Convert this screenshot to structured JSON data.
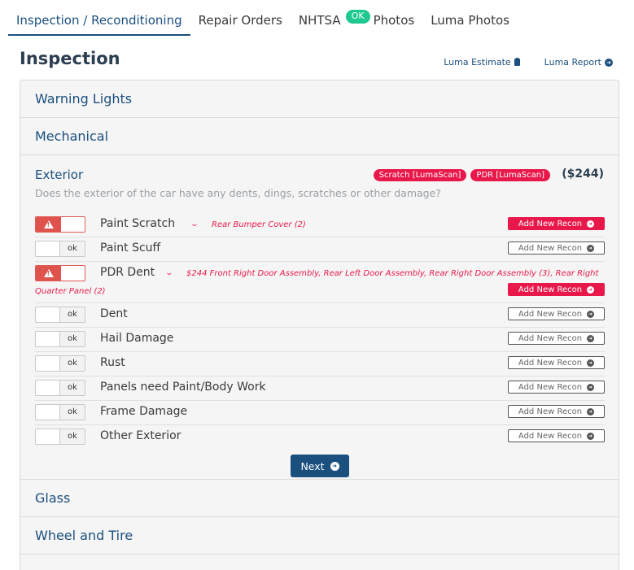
{
  "tabs": [
    {
      "label": "Inspection / Reconditioning"
    },
    {
      "label": "Repair Orders"
    },
    {
      "label": "NHTSA",
      "badge": "OK"
    },
    {
      "label": "Photos"
    },
    {
      "label": "Luma Photos"
    }
  ],
  "page": {
    "title": "Inspection",
    "luma_estimate": "Luma Estimate",
    "luma_report": "Luma Report"
  },
  "sections": {
    "warning_lights": "Warning Lights",
    "mechanical": "Mechanical",
    "glass": "Glass",
    "wheel_tire": "Wheel and Tire"
  },
  "exterior": {
    "title": "Exterior",
    "tags": [
      "Scratch [LumaScan]",
      "PDR [LumaScan]"
    ],
    "total": "($244)",
    "question": "Does the exterior of the car have any dents, dings, scratches or other damage?",
    "ok_label": "ok",
    "recon_label": "Add New Recon",
    "rows": [
      {
        "label": "Paint Scratch",
        "flagged": true,
        "detail": "Rear Bumper Cover (2)"
      },
      {
        "label": "Paint Scuff",
        "flagged": false
      },
      {
        "label": "PDR Dent",
        "flagged": true,
        "detail": "$244 Front Right Door Assembly, Rear Left Door Assembly, Rear Right Door Assembly (3), Rear Right",
        "detail_cont": "Quarter Panel (2)"
      },
      {
        "label": "Dent",
        "flagged": false
      },
      {
        "label": "Hail Damage",
        "flagged": false
      },
      {
        "label": "Rust",
        "flagged": false
      },
      {
        "label": "Panels need Paint/Body Work",
        "flagged": false
      },
      {
        "label": "Frame Damage",
        "flagged": false
      },
      {
        "label": "Other Exterior",
        "flagged": false
      }
    ],
    "next_label": "Next"
  },
  "colors": {
    "primary": "#1b4f7e",
    "alert": "#e8194a",
    "ok_badge": "#1fc890"
  }
}
